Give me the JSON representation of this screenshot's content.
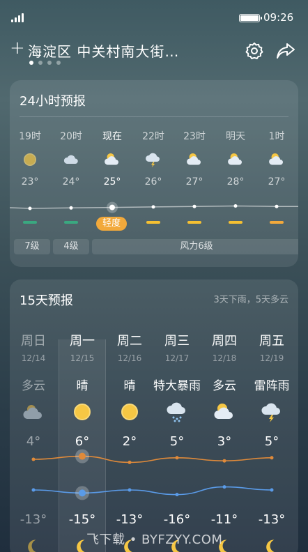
{
  "status_bar": {
    "time": "09:26"
  },
  "header": {
    "location": "海淀区 中关村南大街…",
    "page_count": 4,
    "active_page": 0
  },
  "hourly": {
    "title": "24小时预报",
    "items": [
      {
        "time": "19时",
        "temp": "23°",
        "icon": "sun-icon",
        "aqi_color": "#3aa880"
      },
      {
        "time": "20时",
        "temp": "24°",
        "icon": "cloud-icon",
        "aqi_color": "#3aa880"
      },
      {
        "time": "现在",
        "temp": "25°",
        "icon": "partly-cloudy-icon",
        "aqi_color": "#f2a93b",
        "now": true
      },
      {
        "time": "22时",
        "temp": "26°",
        "icon": "thunderstorm-icon",
        "aqi_color": "#f5c032"
      },
      {
        "time": "23时",
        "temp": "27°",
        "icon": "partly-cloudy-icon",
        "aqi_color": "#f5c032"
      },
      {
        "time": "明天",
        "temp": "28°",
        "icon": "partly-cloudy-icon",
        "aqi_color": "#f5c032"
      },
      {
        "time": "1时",
        "temp": "27°",
        "icon": "partly-cloudy-icon",
        "aqi_color": "#f2a93b"
      }
    ],
    "aqi_label": "轻度",
    "wind": [
      "7级",
      "4级",
      "风力6级"
    ]
  },
  "daily": {
    "title": "15天预报",
    "subtitle": "3天下雨，5天多云",
    "days": [
      {
        "week": "周日",
        "date": "12/14",
        "cond": "多云",
        "high": "4°",
        "low": "-13°",
        "icon": "cloudy-icon",
        "past": true
      },
      {
        "week": "周一",
        "date": "12/15",
        "cond": "晴",
        "high": "6°",
        "low": "-15°",
        "icon": "sun-icon",
        "today": true
      },
      {
        "week": "周二",
        "date": "12/16",
        "cond": "晴",
        "high": "2°",
        "low": "-13°",
        "icon": "sun-icon"
      },
      {
        "week": "周三",
        "date": "12/17",
        "cond": "特大暴雨",
        "high": "5°",
        "low": "-16°",
        "icon": "heavy-rain-icon"
      },
      {
        "week": "周四",
        "date": "12/18",
        "cond": "多云",
        "high": "3°",
        "low": "-11°",
        "icon": "partly-cloudy-icon"
      },
      {
        "week": "周五",
        "date": "12/19",
        "cond": "雷阵雨",
        "high": "5°",
        "low": "-13°",
        "icon": "thunderstorm-icon"
      }
    ]
  },
  "watermark": "飞下载 • BYFZYY.COM",
  "colors": {
    "high_line": "#e08a3a",
    "low_line": "#5a9be8",
    "aqi_moderate": "#f2a93b"
  }
}
